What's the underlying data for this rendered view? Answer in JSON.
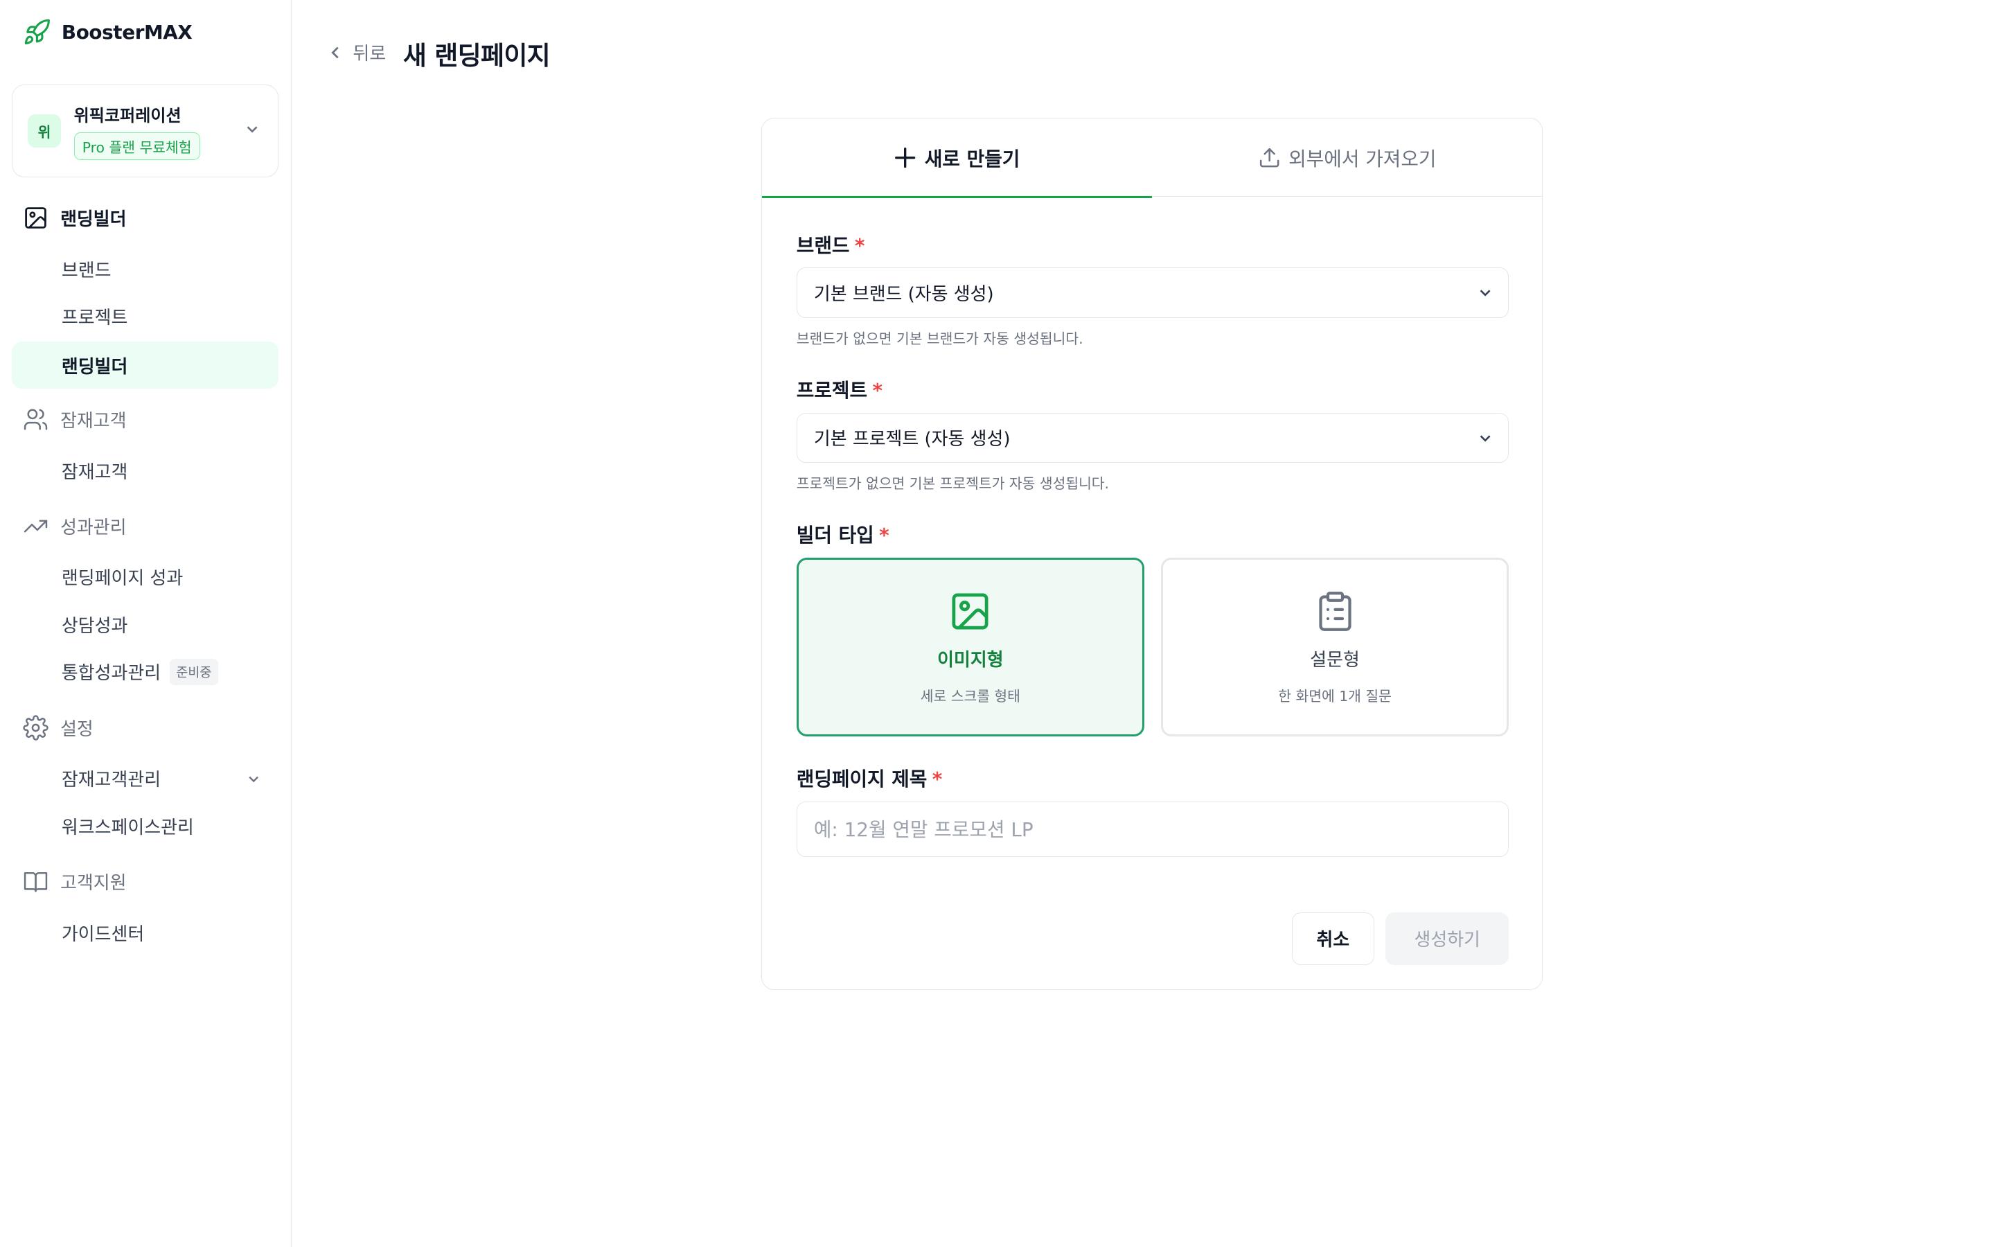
{
  "app": {
    "name": "BoosterMAX"
  },
  "org": {
    "avatar": "위",
    "name": "위픽코퍼레이션",
    "plan_badge": "Pro 플랜 무료체험"
  },
  "sidebar": {
    "sections": [
      {
        "label": "랜딩빌더",
        "icon": "image-icon"
      },
      {
        "label": "잠재고객",
        "icon": "users-icon"
      },
      {
        "label": "성과관리",
        "icon": "trending-up-icon"
      },
      {
        "label": "설정",
        "icon": "gear-icon"
      },
      {
        "label": "고객지원",
        "icon": "book-icon"
      }
    ],
    "items": {
      "brand": "브랜드",
      "project": "프로젝트",
      "landing_builder": "랜딩빌더",
      "prospects": "잠재고객",
      "landing_performance": "랜딩페이지 성과",
      "consult_performance": "상담성과",
      "integrated_performance": "통합성과관리",
      "integrated_badge": "준비중",
      "prospect_management": "잠재고객관리",
      "workspace_management": "워크스페이스관리",
      "guide_center": "가이드센터"
    }
  },
  "header": {
    "back_label": "뒤로",
    "title": "새 랜딩페이지"
  },
  "tabs": [
    {
      "label": "새로 만들기",
      "active": true
    },
    {
      "label": "외부에서 가져오기",
      "active": false
    }
  ],
  "form": {
    "brand": {
      "label": "브랜드",
      "required_mark": "*",
      "value": "기본 브랜드 (자동 생성)",
      "help": "브랜드가 없으면 기본 브랜드가 자동 생성됩니다."
    },
    "project": {
      "label": "프로젝트",
      "required_mark": "*",
      "value": "기본 프로젝트 (자동 생성)",
      "help": "프로젝트가 없으면 기본 프로젝트가 자동 생성됩니다."
    },
    "builder_type": {
      "label": "빌더 타입",
      "required_mark": "*",
      "options": [
        {
          "title": "이미지형",
          "desc": "세로 스크롤 형태",
          "selected": true,
          "icon": "image-icon"
        },
        {
          "title": "설문형",
          "desc": "한 화면에 1개 질문",
          "selected": false,
          "icon": "clipboard-icon"
        }
      ]
    },
    "title": {
      "label": "랜딩페이지 제목",
      "required_mark": "*",
      "value": "",
      "placeholder": "예: 12월 연말 프로모션 LP"
    },
    "cancel_label": "취소",
    "submit_label": "생성하기"
  },
  "colors": {
    "accent": "#16a34a",
    "required": "#ef4444",
    "selected_bg": "#f0faf5"
  }
}
